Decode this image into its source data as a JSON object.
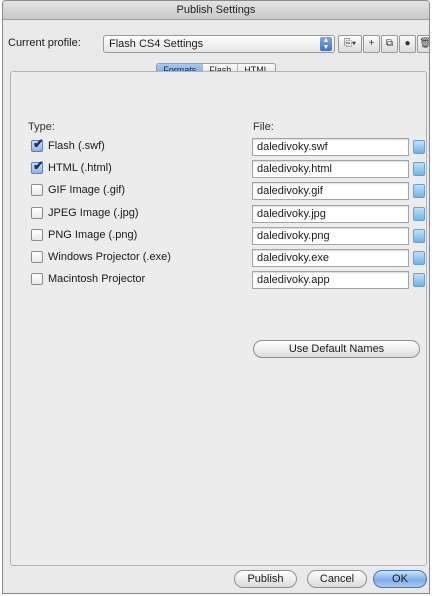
{
  "window": {
    "title": "Publish Settings"
  },
  "profile": {
    "label": "Current profile:",
    "value": "Flash CS4 Settings",
    "tools": [
      {
        "icon": "import-export-icon",
        "glyph": "⎘▾"
      },
      {
        "icon": "add-profile-icon",
        "glyph": "+"
      },
      {
        "icon": "duplicate-profile-icon",
        "glyph": "⧉"
      },
      {
        "icon": "profile-settings-icon",
        "glyph": "●"
      },
      {
        "icon": "delete-profile-icon",
        "glyph": "🗑"
      }
    ]
  },
  "tabs": [
    {
      "label": "Formats",
      "active": true
    },
    {
      "label": "Flash",
      "active": false
    },
    {
      "label": "HTML",
      "active": false
    }
  ],
  "columns": {
    "type": "Type:",
    "file": "File:"
  },
  "formats": [
    {
      "label": "Flash  (.swf)",
      "checked": true,
      "file": "daledivoky.swf"
    },
    {
      "label": "HTML (.html)",
      "checked": true,
      "file": "daledivoky.html"
    },
    {
      "label": "GIF Image (.gif)",
      "checked": false,
      "file": "daledivoky.gif"
    },
    {
      "label": "JPEG Image (.jpg)",
      "checked": false,
      "file": "daledivoky.jpg"
    },
    {
      "label": "PNG Image (.png)",
      "checked": false,
      "file": "daledivoky.png"
    },
    {
      "label": "Windows Projector (.exe)",
      "checked": false,
      "file": "daledivoky.exe"
    },
    {
      "label": "Macintosh Projector",
      "checked": false,
      "file": "daledivoky.app"
    }
  ],
  "buttons": {
    "default_names": "Use Default Names",
    "publish": "Publish",
    "cancel": "Cancel",
    "ok": "OK"
  },
  "colors": {
    "accent": "#6f9fdc",
    "checked": "#8fb2e6"
  }
}
